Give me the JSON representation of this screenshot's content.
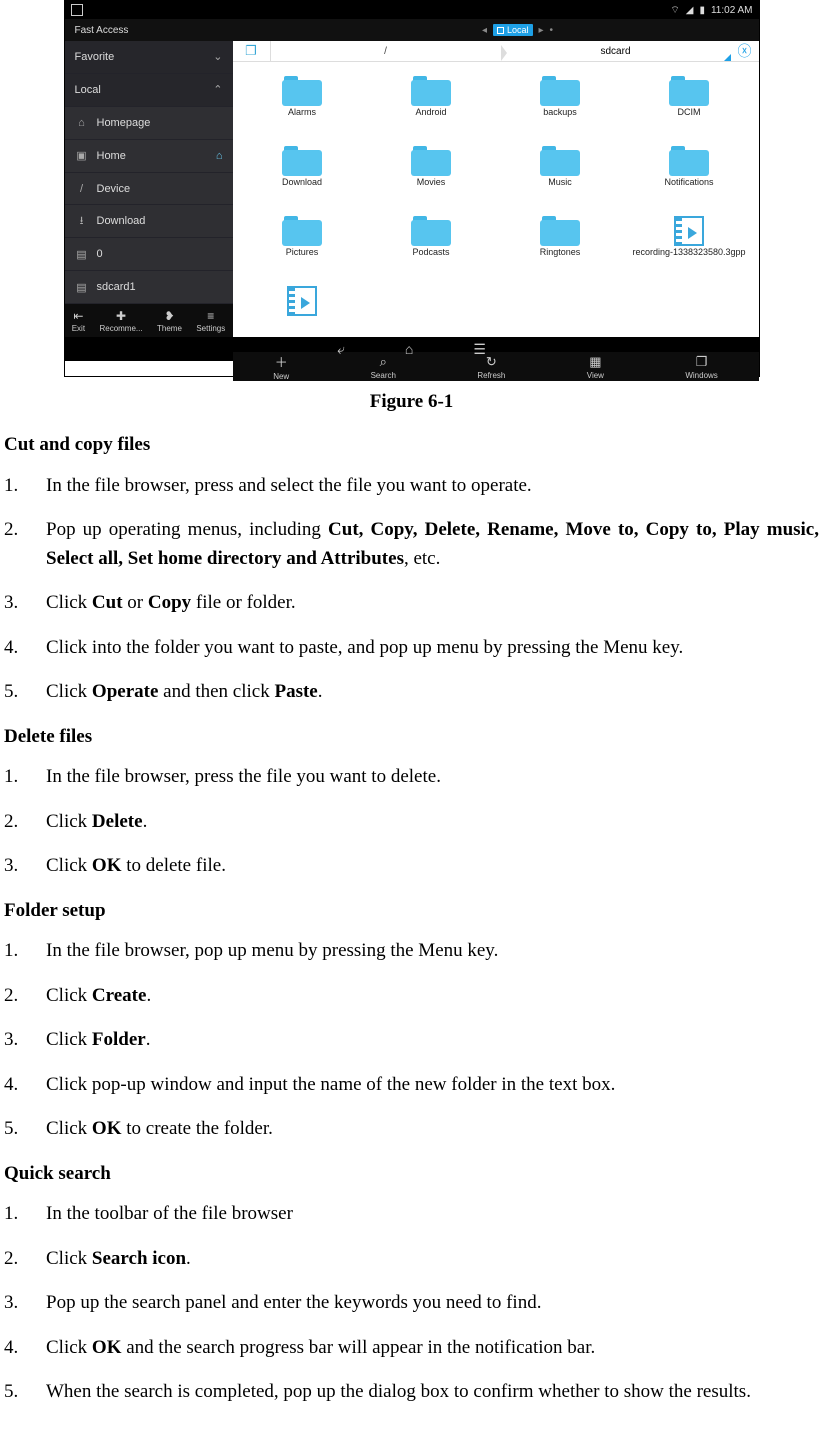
{
  "screenshot": {
    "statusbar": {
      "time": "11:02 AM"
    },
    "appbar": {
      "fast_access": "Fast Access",
      "tab_label": "Local",
      "arrow": "▸",
      "dot": "•"
    },
    "sidebar": {
      "favorite": "Favorite",
      "local": "Local",
      "items": [
        {
          "label": "Homepage"
        },
        {
          "label": "Home"
        },
        {
          "label": "Device"
        },
        {
          "label": "Download"
        },
        {
          "label": "0"
        },
        {
          "label": "sdcard1"
        }
      ],
      "bottom": [
        {
          "label": "Exit"
        },
        {
          "label": "Recomme..."
        },
        {
          "label": "Theme"
        },
        {
          "label": "Settings"
        }
      ]
    },
    "pathbar": {
      "root": "/",
      "current": "sdcard"
    },
    "grid": [
      {
        "type": "folder",
        "label": "Alarms"
      },
      {
        "type": "folder",
        "label": "Android"
      },
      {
        "type": "folder",
        "label": "backups"
      },
      {
        "type": "folder",
        "label": "DCIM"
      },
      {
        "type": "folder",
        "label": "Download"
      },
      {
        "type": "folder",
        "label": "Movies"
      },
      {
        "type": "folder",
        "label": "Music"
      },
      {
        "type": "folder",
        "label": "Notifications"
      },
      {
        "type": "folder",
        "label": "Pictures"
      },
      {
        "type": "folder",
        "label": "Podcasts"
      },
      {
        "type": "folder",
        "label": "Ringtones"
      },
      {
        "type": "video",
        "label": "recording-1338323580.3gpp"
      },
      {
        "type": "video",
        "label": ""
      }
    ],
    "mainbar": [
      {
        "label": "New"
      },
      {
        "label": "Search"
      },
      {
        "label": "Refresh"
      },
      {
        "label": "View"
      },
      {
        "label": "Windows"
      }
    ]
  },
  "caption": "Figure 6-1",
  "sections": {
    "cutcopy": {
      "title": "Cut and copy files",
      "steps": {
        "s1": "In the file browser, press and select the file you want to operate.",
        "s2a": "Pop up operating menus, including ",
        "s2b": "Cut, Copy, Delete, Rename, Move to, Copy to, Play music, Select all, Set home directory and Attributes",
        "s2c": ", etc.",
        "s3a": "Click ",
        "s3cut": "Cut",
        "s3b": " or ",
        "s3copy": "Copy",
        "s3c": " file or folder.",
        "s4": "Click into the folder you want to paste, and pop up menu by pressing the Menu key.",
        "s5a": "Click ",
        "s5op": "Operate",
        "s5b": " and then click ",
        "s5paste": "Paste",
        "s5c": "."
      }
    },
    "delete": {
      "title": "Delete files",
      "steps": {
        "s1": "In the file browser, press the file you want to delete.",
        "s2a": "Click ",
        "s2b": "Delete",
        "s2c": ".",
        "s3a": "Click ",
        "s3b": "OK",
        "s3c": " to delete file."
      }
    },
    "folder": {
      "title": "Folder setup",
      "steps": {
        "s1": "In the file browser, pop up menu by pressing the Menu key.",
        "s2a": "Click ",
        "s2b": "Create",
        "s2c": ".",
        "s3a": "Click ",
        "s3b": "Folder",
        "s3c": ".",
        "s4": "Click pop-up window and input the name of the new folder in the text box.",
        "s5a": "Click ",
        "s5b": "OK",
        "s5c": " to create the folder."
      }
    },
    "search": {
      "title": "Quick search",
      "steps": {
        "s1": "In the toolbar of the file browser",
        "s2a": "Click ",
        "s2b": "Search icon",
        "s2c": ".",
        "s3": "Pop up the search panel and enter the keywords you need to find.",
        "s4a": "Click ",
        "s4b": "OK",
        "s4c": " and the search progress bar will appear in the notification bar.",
        "s5": "When the search is completed, pop up the dialog box to confirm whether to show the results."
      }
    }
  }
}
